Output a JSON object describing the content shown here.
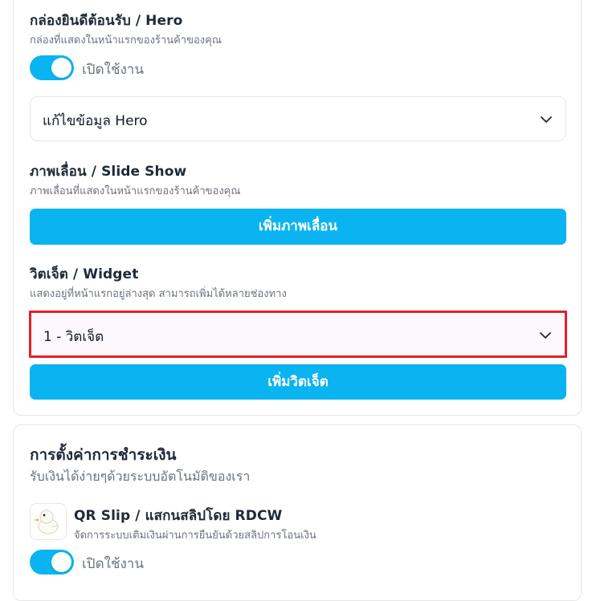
{
  "hero": {
    "title": "กล่องยินดีต้อนรับ / Hero",
    "subtitle": "กล่องที่แสดงในหน้าแรกของร้านค้าของคุณ",
    "toggle_label": "เปิดใช้งาน",
    "toggle_on": true,
    "edit_label": "แก้ไขข้อมูล Hero"
  },
  "slideshow": {
    "title": "ภาพเลื่อน / Slide Show",
    "subtitle": "ภาพเลื่อนที่แสดงในหน้าแรกของร้านค้าของคุณ",
    "add_button": "เพิ่มภาพเลื่อน"
  },
  "widget": {
    "title": "วิตเจ็ต / Widget",
    "subtitle": "แสดงอยู่ที่หน้าแรกอยู่ล่างสุด สามารถเพิ่มได้หลายช่องทาง",
    "item_label": "1 - วิตเจ็ต",
    "add_button": "เพิ่มวิตเจ็ต"
  },
  "payment": {
    "title": "การตั้งค่าการชำระเงิน",
    "subtitle": "รับเงินได้ง่ายๆด้วยระบบอัตโนมัติของเรา",
    "method": {
      "icon": "duck-icon",
      "title": "QR Slip / แสกนสลิปโดย RDCW",
      "subtitle": "จัดการระบบเติมเงินผ่านการยืนยันด้วยสลิปการโอนเงิน",
      "toggle_label": "เปิดใช้งาน",
      "toggle_on": true
    }
  },
  "colors": {
    "accent": "#0ab4f0",
    "highlight_border": "#e4202a",
    "border": "#e5e7eb",
    "muted_text": "#6b7280"
  }
}
